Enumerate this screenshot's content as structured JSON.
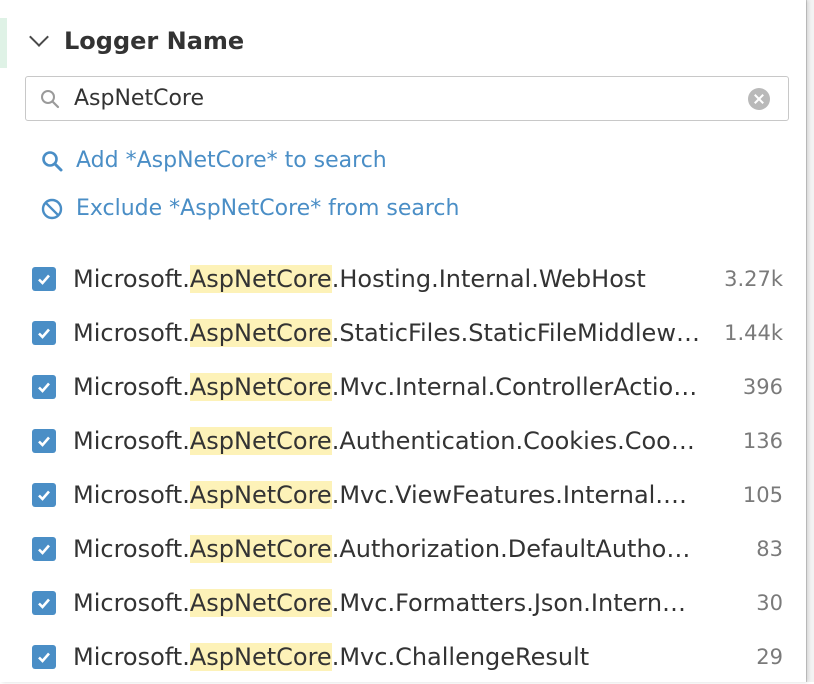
{
  "panel": {
    "title": "Logger Name",
    "search": {
      "value": "AspNetCore"
    },
    "actions": [
      {
        "label": "Add *AspNetCore* to search",
        "icon": "search-icon"
      },
      {
        "label": "Exclude *AspNetCore* from search",
        "icon": "ban-icon"
      }
    ],
    "facets": [
      {
        "prefix": "Microsoft.",
        "highlight": "AspNetCore",
        "suffix": ".Hosting.Internal.WebHost",
        "count": "3.27k",
        "checked": true
      },
      {
        "prefix": "Microsoft.",
        "highlight": "AspNetCore",
        "suffix": ".StaticFiles.StaticFileMiddlew…",
        "count": "1.44k",
        "checked": true
      },
      {
        "prefix": "Microsoft.",
        "highlight": "AspNetCore",
        "suffix": ".Mvc.Internal.ControllerActio…",
        "count": "396",
        "checked": true
      },
      {
        "prefix": "Microsoft.",
        "highlight": "AspNetCore",
        "suffix": ".Authentication.Cookies.Coo…",
        "count": "136",
        "checked": true
      },
      {
        "prefix": "Microsoft.",
        "highlight": "AspNetCore",
        "suffix": ".Mvc.ViewFeatures.Internal.…",
        "count": "105",
        "checked": true
      },
      {
        "prefix": "Microsoft.",
        "highlight": "AspNetCore",
        "suffix": ".Authorization.DefaultAutho…",
        "count": "83",
        "checked": true
      },
      {
        "prefix": "Microsoft.",
        "highlight": "AspNetCore",
        "suffix": ".Mvc.Formatters.Json.Intern…",
        "count": "30",
        "checked": true
      },
      {
        "prefix": "Microsoft.",
        "highlight": "AspNetCore",
        "suffix": ".Mvc.ChallengeResult",
        "count": "29",
        "checked": true
      }
    ]
  },
  "colors": {
    "accent": "#4a8ec6",
    "highlight": "#fdf2b8",
    "text": "#333333",
    "muted": "#7a7a7a"
  }
}
